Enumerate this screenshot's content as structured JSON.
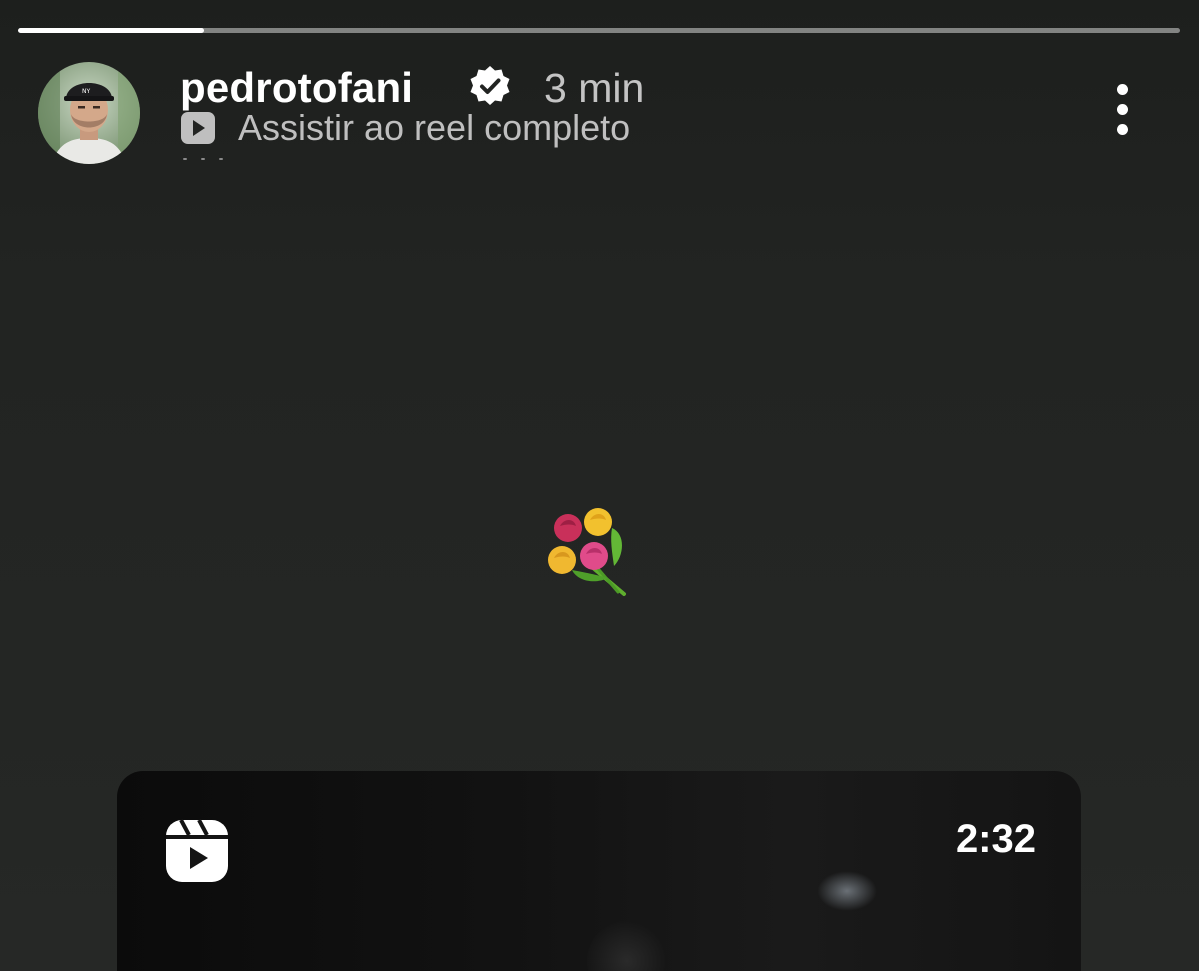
{
  "story": {
    "progress": 0.16,
    "username": "pedrotofani",
    "verified": true,
    "timestamp": "3 min",
    "reel_link_label": "Assistir ao reel completo",
    "truncated_caption": "..."
  },
  "sticker": {
    "emoji_name": "bouquet-icon"
  },
  "reel_card": {
    "duration": "2:32",
    "icon": "reels-icon"
  },
  "colors": {
    "background": "#222422",
    "text_primary": "#ffffff",
    "text_secondary": "#c4c4c4"
  }
}
